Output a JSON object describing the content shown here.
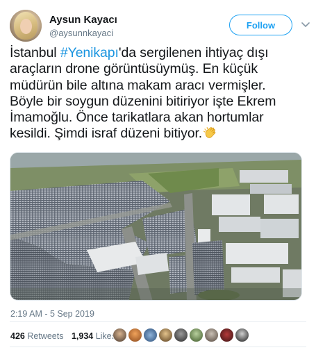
{
  "user": {
    "display_name": "Aysun Kayacı",
    "handle": "@aysunnkayaci"
  },
  "actions": {
    "follow_label": "Follow"
  },
  "tweet": {
    "line1_pre": "İstanbul ",
    "hashtag": "#Yenikapı",
    "line1_post": "'da sergilenen ihtiyaç dışı",
    "line2": "araçların drone görüntüsüymüş. En küçük",
    "line3": "müdürün bile altına makam aracı vermişler.",
    "line4": "Böyle bir soygun düzenini bitiriyor işte Ekrem",
    "line5": "İmamoğlu. Önce tarikatlara akan hortumlar",
    "line6": "kesildi. Şimdi israf düzeni bitiyor.",
    "emoji": "clapping-hands-emoji"
  },
  "meta": {
    "timestamp": "2:19 AM - 5 Sep 2019"
  },
  "stats": {
    "retweets_count": "426",
    "retweets_label": "Retweets",
    "likes_count": "1,934",
    "likes_label": "Likes"
  },
  "colors": {
    "accent": "#1da1f2",
    "hashtag": "#1b95e0",
    "muted": "#657786",
    "text": "#14171a"
  }
}
